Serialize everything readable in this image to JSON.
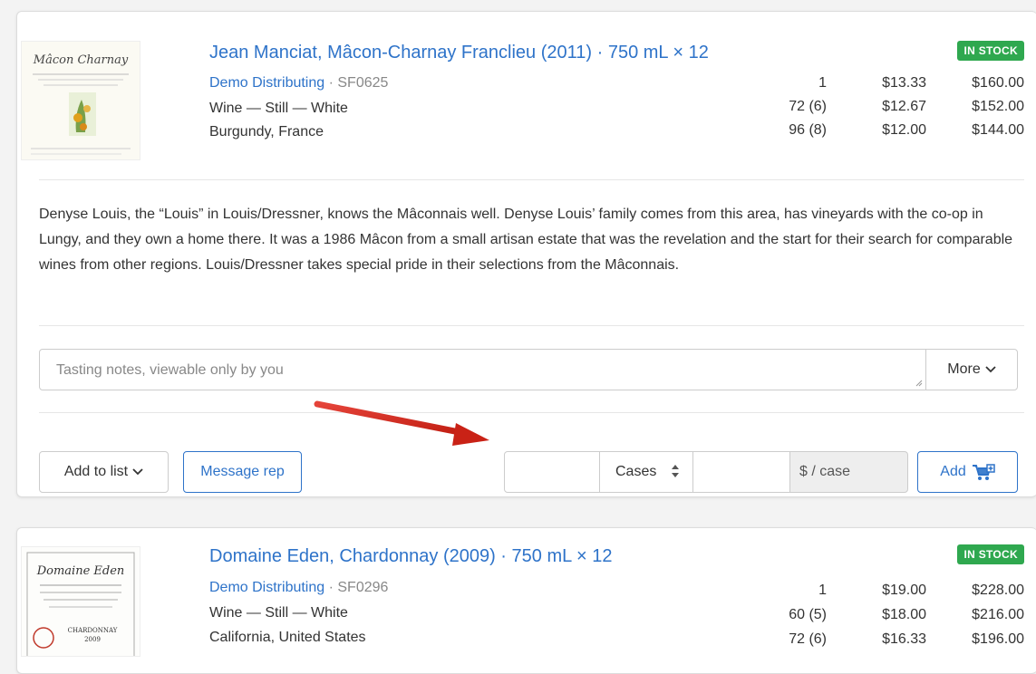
{
  "products": [
    {
      "title": "Jean Manciat, Mâcon-Charnay Franclieu (2011) · 750 mL × 12",
      "label_text": "Mâcon Charnay",
      "distributor": "Demo Distributing",
      "sku": " · SF0625",
      "type": "Wine — Still — White",
      "region": "Burgundy, France",
      "stock_badge": "IN STOCK",
      "pricing": [
        {
          "qty": "1",
          "unit": "$13.33",
          "case": "$160.00"
        },
        {
          "qty": "72 (6)",
          "unit": "$12.67",
          "case": "$152.00"
        },
        {
          "qty": "96 (8)",
          "unit": "$12.00",
          "case": "$144.00"
        }
      ],
      "description": "Denyse Louis, the “Louis” in Louis/Dressner, knows the Mâconnais well. Denyse Louis’ family comes from this area, has vineyards with the co-op in Lungy, and they own a home there. It was a 1986 Mâcon from a small artisan estate that was the revelation and the start for their search for comparable wines from other regions. Louis/Dressner takes special pride in their selections from the Mâconnais.",
      "notes_placeholder": "Tasting notes, viewable only by you",
      "more_label": "More",
      "add_to_list_label": "Add to list",
      "message_rep_label": "Message rep",
      "unit_select_value": "Cases",
      "price_unit_label": "$ / case",
      "add_label": "Add"
    },
    {
      "title": "Domaine Eden, Chardonnay (2009) · 750 mL × 12",
      "label_text": "Domaine Eden",
      "label_varietal": "CHARDONNAY",
      "label_year": "2009",
      "distributor": "Demo Distributing",
      "sku": " · SF0296",
      "type": "Wine — Still — White",
      "region": "California, United States",
      "stock_badge": "IN STOCK",
      "pricing": [
        {
          "qty": "1",
          "unit": "$19.00",
          "case": "$228.00"
        },
        {
          "qty": "60 (5)",
          "unit": "$18.00",
          "case": "$216.00"
        },
        {
          "qty": "72 (6)",
          "unit": "$16.33",
          "case": "$196.00"
        }
      ]
    }
  ],
  "colors": {
    "link": "#2e73c9",
    "badge": "#2fa84f",
    "annotation_arrow": "#d62b1f"
  }
}
